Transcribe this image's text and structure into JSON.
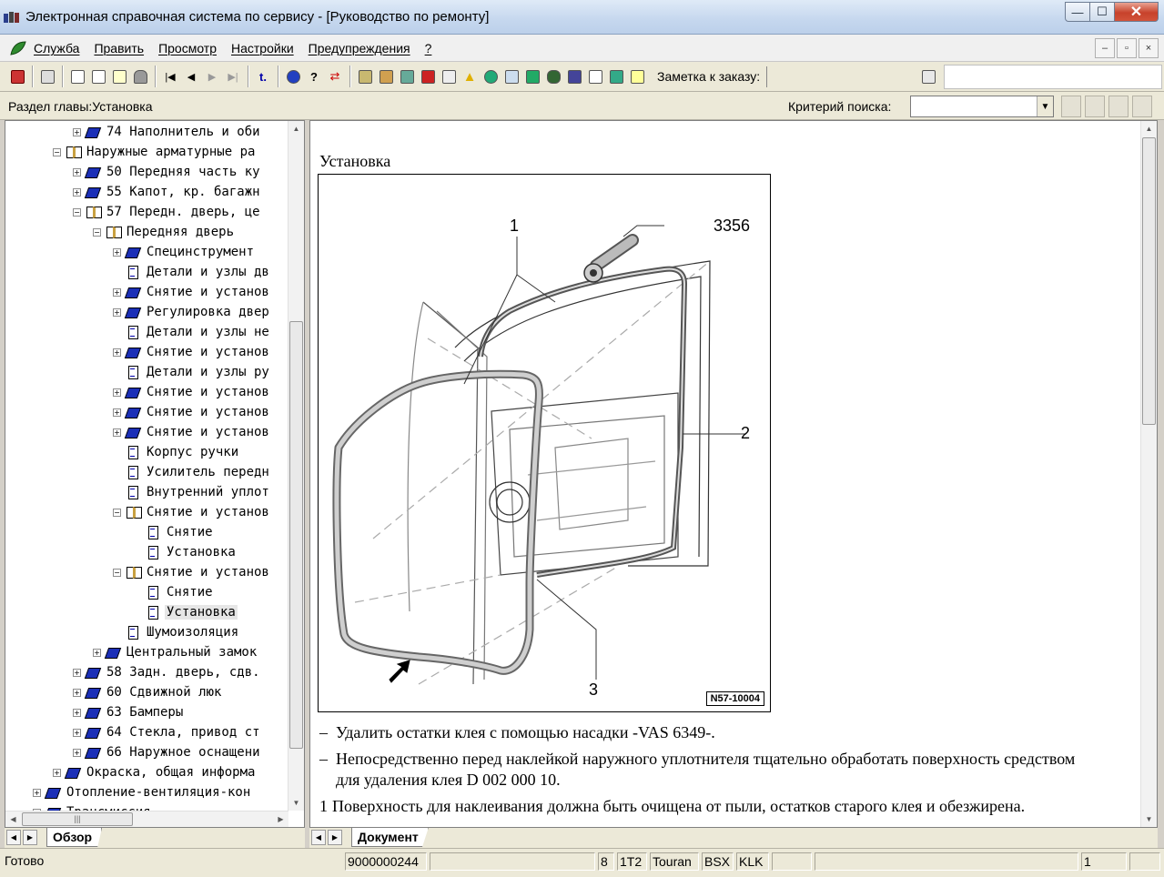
{
  "window": {
    "title": "Электронная справочная система по сервису - [Руководство по ремонту]",
    "buttons": [
      "—",
      "☐",
      "✕"
    ]
  },
  "menu": {
    "items": [
      "Служба",
      "Править",
      "Просмотр",
      "Настройки",
      "Предупреждения",
      "?"
    ],
    "mdi_buttons": [
      "–",
      "▫",
      "×"
    ]
  },
  "toolbar": {
    "order_label": "Заметка к заказу:"
  },
  "chapterbar": {
    "chapter": "Раздел главы:Установка",
    "criteria_label": "Критерий  поиска:",
    "criteria_value": ""
  },
  "tree": {
    "items": [
      {
        "level": 2,
        "expander": "+",
        "icon": "book",
        "label": "74 Наполнитель и оби"
      },
      {
        "level": 1,
        "expander": "−",
        "icon": "openbook",
        "label": "Наружные арматурные ра"
      },
      {
        "level": 2,
        "expander": "+",
        "icon": "book",
        "label": "50 Передняя часть ку"
      },
      {
        "level": 2,
        "expander": "+",
        "icon": "book",
        "label": "55 Капот, кр. багажн"
      },
      {
        "level": 2,
        "expander": "−",
        "icon": "openbook",
        "label": "57 Передн. дверь, це"
      },
      {
        "level": 3,
        "expander": "−",
        "icon": "openbook",
        "label": "Передняя дверь"
      },
      {
        "level": 4,
        "expander": "+",
        "icon": "book",
        "label": "Специнструмент"
      },
      {
        "level": 4,
        "expander": "",
        "icon": "doc",
        "label": "Детали и узлы дв"
      },
      {
        "level": 4,
        "expander": "+",
        "icon": "book",
        "label": "Снятие и установ"
      },
      {
        "level": 4,
        "expander": "+",
        "icon": "book",
        "label": "Регулировка двер"
      },
      {
        "level": 4,
        "expander": "",
        "icon": "doc",
        "label": "Детали и узлы не"
      },
      {
        "level": 4,
        "expander": "+",
        "icon": "book",
        "label": "Снятие и установ"
      },
      {
        "level": 4,
        "expander": "",
        "icon": "doc",
        "label": "Детали и узлы ру"
      },
      {
        "level": 4,
        "expander": "+",
        "icon": "book",
        "label": "Снятие и установ"
      },
      {
        "level": 4,
        "expander": "+",
        "icon": "book",
        "label": "Снятие и установ"
      },
      {
        "level": 4,
        "expander": "+",
        "icon": "book",
        "label": "Снятие и установ"
      },
      {
        "level": 4,
        "expander": "",
        "icon": "doc",
        "label": "Корпус ручки"
      },
      {
        "level": 4,
        "expander": "",
        "icon": "doc",
        "label": "Усилитель передн"
      },
      {
        "level": 4,
        "expander": "",
        "icon": "doc",
        "label": "Внутренний уплот"
      },
      {
        "level": 4,
        "expander": "−",
        "icon": "openbook",
        "label": "Снятие и установ"
      },
      {
        "level": 5,
        "expander": "",
        "icon": "doc",
        "label": "Снятие"
      },
      {
        "level": 5,
        "expander": "",
        "icon": "doc",
        "label": "Установка"
      },
      {
        "level": 4,
        "expander": "−",
        "icon": "openbook",
        "label": "Снятие и установ"
      },
      {
        "level": 5,
        "expander": "",
        "icon": "doc",
        "label": "Снятие"
      },
      {
        "level": 5,
        "expander": "",
        "icon": "doc",
        "label": "Установка",
        "selected": true
      },
      {
        "level": 4,
        "expander": "",
        "icon": "doc",
        "label": "Шумоизоляция"
      },
      {
        "level": 3,
        "expander": "+",
        "icon": "book",
        "label": "Центральный замок"
      },
      {
        "level": 2,
        "expander": "+",
        "icon": "book",
        "label": "58 Задн. дверь, сдв."
      },
      {
        "level": 2,
        "expander": "+",
        "icon": "book",
        "label": "60 Сдвижной люк"
      },
      {
        "level": 2,
        "expander": "+",
        "icon": "book",
        "label": "63 Бамперы"
      },
      {
        "level": 2,
        "expander": "+",
        "icon": "book",
        "label": "64 Стекла, привод ст"
      },
      {
        "level": 2,
        "expander": "+",
        "icon": "book",
        "label": "66 Наружное оснащени"
      },
      {
        "level": 1,
        "expander": "+",
        "icon": "book",
        "label": "Окраска, общая информа"
      },
      {
        "level": 0,
        "expander": "+",
        "icon": "book",
        "label": "Отопление-вентиляция-кон"
      },
      {
        "level": 0,
        "expander": "+",
        "icon": "book",
        "label": "Трансмиссия"
      }
    ]
  },
  "tabs": {
    "left": "Обзор",
    "right": "Документ"
  },
  "document": {
    "title": "Установка",
    "callouts": {
      "c1": "1",
      "c2": "2",
      "c3": "3",
      "tool": "3356"
    },
    "figure_code": "N57-10004",
    "steps": [
      {
        "marker": "–",
        "text": "Удалить остатки клея с помощью насадки -VAS 6349-."
      },
      {
        "marker": "–",
        "text": "Непосредственно перед наклейкой наружного уплотнителя тщательно обработать поверхность средством для удаления клея D 002 000 10."
      },
      {
        "marker": "1",
        "text": "Поверхность для наклеивания должна быть очищена от пыли, остатков старого клея и обезжирена."
      }
    ]
  },
  "status": {
    "ready": "Готово",
    "order": "9000000244",
    "f1": "8",
    "f2": "1T2",
    "f3": "Touran",
    "f4": "BSX",
    "f5": "KLK",
    "page": "1"
  }
}
